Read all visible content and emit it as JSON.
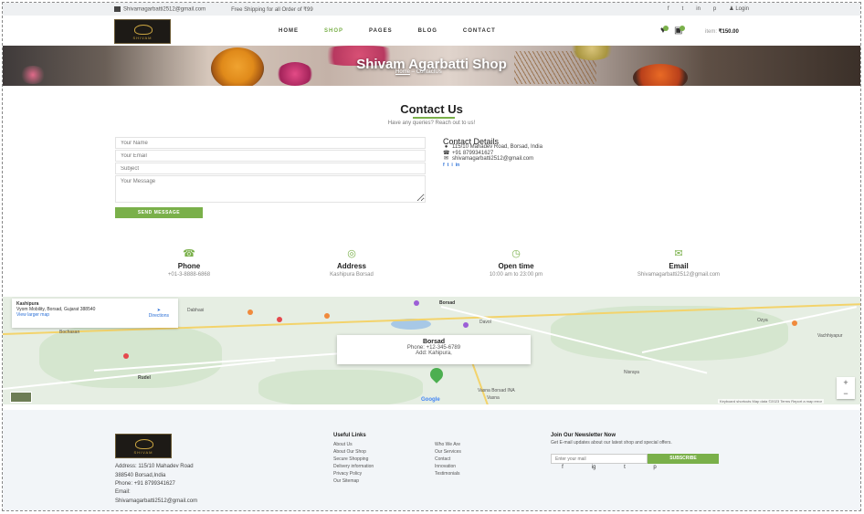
{
  "topbar": {
    "email": "Shivamagarbatti2512@gmail.com",
    "shipping": "Free Shipping for all Order of ₹99",
    "login": "Login",
    "social": [
      "f",
      "t",
      "in",
      "p"
    ]
  },
  "header": {
    "logo_text": "SHIVAM",
    "nav": [
      "HOME",
      "SHOP",
      "PAGES",
      "BLOG",
      "CONTACT"
    ],
    "active_nav": "SHOP",
    "cart_label": "item:",
    "cart_total": "₹150.00"
  },
  "banner": {
    "title": "Shivam Agarbatti Shop",
    "crumb_home": "Home",
    "crumb_current": "ContactUs"
  },
  "contact": {
    "title": "Contact Us",
    "subtitle": "Have any queries? Reach out to us!",
    "form": {
      "name_placeholder": "Your Name",
      "email_placeholder": "Your Email",
      "subject_placeholder": "Subject",
      "message_placeholder": "Your Message",
      "send_label": "SEND MESSAGE"
    },
    "details": {
      "title": "Contact Details",
      "address": "115/10 Mahadev Road, Borsad, India",
      "phone": "+91 8799341627",
      "email": "shivamagarbatti2512@gmail.com",
      "social": [
        "f",
        "t",
        "i",
        "in"
      ]
    }
  },
  "info": [
    {
      "icon": "phone-icon",
      "title": "Phone",
      "value": "+01-3-8888-6868"
    },
    {
      "icon": "location-icon",
      "title": "Address",
      "value": "Kashipura Borsad"
    },
    {
      "icon": "clock-icon",
      "title": "Open time",
      "value": "10:00 am to 23:00 pm"
    },
    {
      "icon": "envelope-icon",
      "title": "Email",
      "value": "Shivamagarbatti2512@gmail.com"
    }
  ],
  "map": {
    "card_title": "Kashipura",
    "card_address": "Vyom Mobility, Borsad, Gujarat 388540",
    "card_link": "View larger map",
    "directions": "Directions",
    "popup_title": "Borsad",
    "popup_phone": "Phone: +12-345-6789",
    "popup_addr": "Add: Kahipura,",
    "places": [
      "Dabhasi",
      "Bochasan",
      "Borsad",
      "Davol",
      "Rudel",
      "Nisraya",
      "Vasna Borsad INA",
      "Vasna",
      "Vachhiyapur",
      "Bochasan",
      "Ozya"
    ],
    "google": "Google",
    "attrib": "Keyboard shortcuts   Map data ©2023   Terms   Report a map error"
  },
  "footer": {
    "logo_text": "SHIVAM",
    "address": "Address: 115/10 Mahadev Road",
    "address2": "388540 Borsad,India",
    "phone": "Phone: +91 8799341627",
    "email_label": "Email:",
    "email": "Shivamagarbatti2512@gmail.com",
    "useful_title": "Useful Links",
    "links_col1": [
      "About Us",
      "About Our Shop",
      "Secure Shopping",
      "Delivery information",
      "Privacy Policy",
      "Our Sitemap"
    ],
    "links_col2": [
      "Who We Are",
      "Our Services",
      "Contact",
      "Innovation",
      "Testimonials"
    ],
    "newsletter_title": "Join Our Newsletter Now",
    "newsletter_text": "Get E-mail updates about our latest shop and special offers.",
    "newsletter_placeholder": "Enter your mail",
    "subscribe_label": "SUBSCRIBE",
    "social": [
      "f",
      "ig",
      "t",
      "p"
    ]
  },
  "colors": {
    "accent": "#7ab04a",
    "topbar": "#eef0f2",
    "footer": "#f2f5f8"
  }
}
